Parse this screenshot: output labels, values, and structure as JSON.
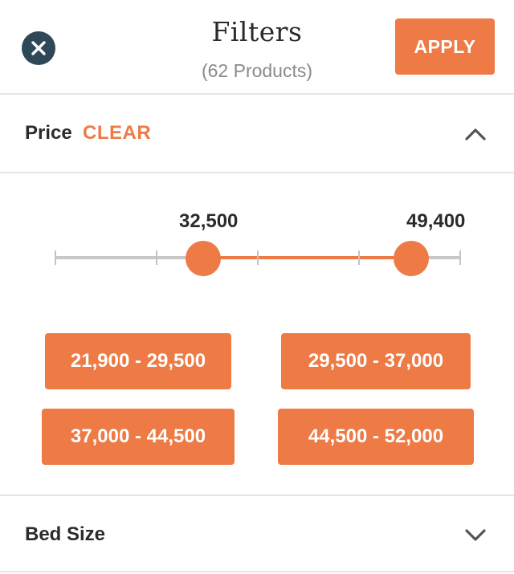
{
  "header": {
    "title": "Filters",
    "product_count": "(62 Products)",
    "apply_label": "APPLY"
  },
  "price": {
    "label": "Price",
    "clear_label": "CLEAR",
    "expanded": true,
    "selected_min": "32,500",
    "selected_max": "49,400",
    "slider": {
      "min": 21900,
      "max": 52000,
      "low": 32500,
      "high": 49400,
      "ticks": 5
    },
    "presets": [
      "21,900 - 29,500",
      "29,500 - 37,000",
      "37,000 - 44,500",
      "44,500 - 52,000"
    ]
  },
  "bed_size": {
    "label": "Bed Size",
    "expanded": false
  },
  "colors": {
    "accent": "#ee7a46",
    "close_bg": "#2f4858",
    "track": "#c8c8c8"
  },
  "icons": {
    "close": "close-icon",
    "collapse": "chevron-up-icon",
    "expand": "chevron-down-icon"
  }
}
